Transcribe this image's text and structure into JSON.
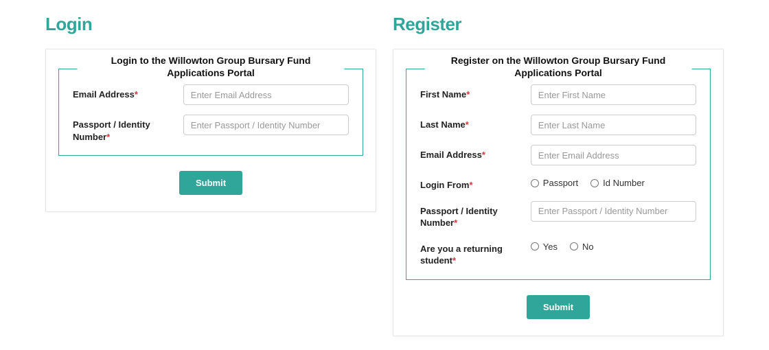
{
  "login": {
    "title": "Login",
    "legend": "Login to the Willowton Group Bursary Fund Applications Portal",
    "email_label": "Email Address",
    "email_placeholder": "Enter Email Address",
    "passport_label": "Passport / Identity Number",
    "passport_placeholder": "Enter Passport / Identity Number",
    "submit_label": "Submit"
  },
  "register": {
    "title": "Register",
    "legend": "Register on the Willowton Group Bursary Fund Applications Portal",
    "first_name_label": "First Name",
    "first_name_placeholder": "Enter First Name",
    "last_name_label": "Last Name",
    "last_name_placeholder": "Enter Last Name",
    "email_label": "Email Address",
    "email_placeholder": "Enter Email Address",
    "login_from_label": "Login From",
    "login_from_options": {
      "passport": "Passport",
      "idnumber": "Id Number"
    },
    "passport_label": "Passport / Identity Number",
    "passport_placeholder": "Enter Passport / Identity Number",
    "returning_label": "Are you a returning student",
    "returning_options": {
      "yes": "Yes",
      "no": "No"
    },
    "submit_label": "Submit"
  },
  "asterisk": "*"
}
